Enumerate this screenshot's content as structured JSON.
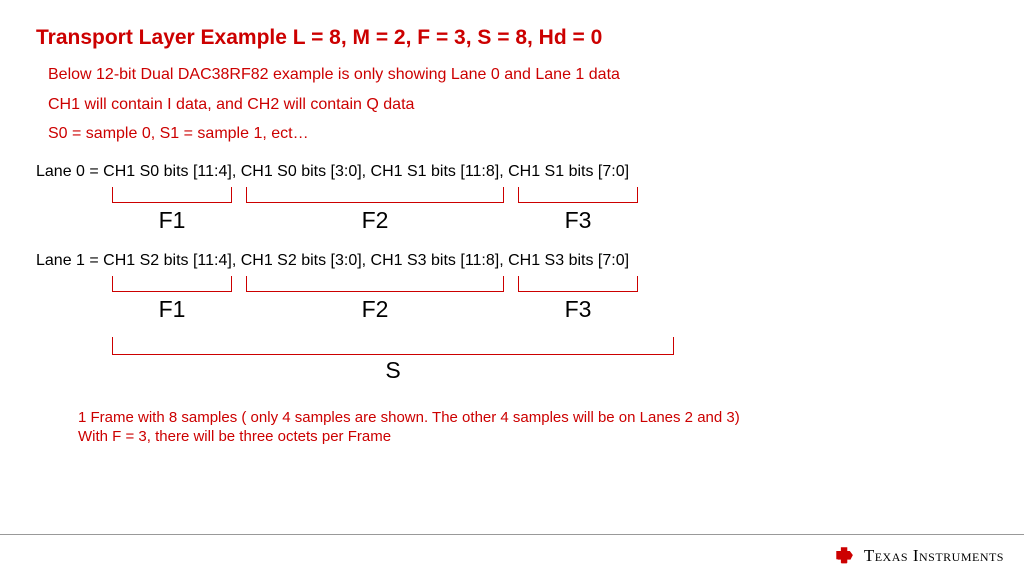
{
  "title": {
    "strong": "Transport Layer Example ",
    "params": "L = 8, M = 2, F = 3, S = 8, Hd = 0"
  },
  "sub": {
    "l1": "Below 12-bit Dual DAC38RF82 example is only showing Lane 0 and Lane 1 data",
    "l2": "CH1 will contain I data, and CH2 will contain Q data",
    "l3": "S0 = sample 0, S1 = sample 1, ect…"
  },
  "lane0": {
    "text": "Lane 0 = CH1 S0 bits [11:4],   CH1 S0 bits [3:0], CH1 S1 bits [11:8],   CH1 S1 bits [7:0]",
    "f1": "F1",
    "f2": "F2",
    "f3": "F3"
  },
  "lane1": {
    "text": "Lane 1 = CH1 S2 bits [11:4],   CH1 S2 bits [3:0], CH1 S3 bits [11:8],   CH1 S3 bits [7:0]",
    "f1": "F1",
    "f2": "F2",
    "f3": "F3"
  },
  "s_label": "S",
  "notes": {
    "l1": "1 Frame with 8 samples ( only 4 samples are shown. The other 4 samples will be on Lanes 2 and 3)",
    "l2": "With F = 3, there will be three octets per Frame"
  },
  "footer": {
    "brand": "Texas Instruments"
  }
}
